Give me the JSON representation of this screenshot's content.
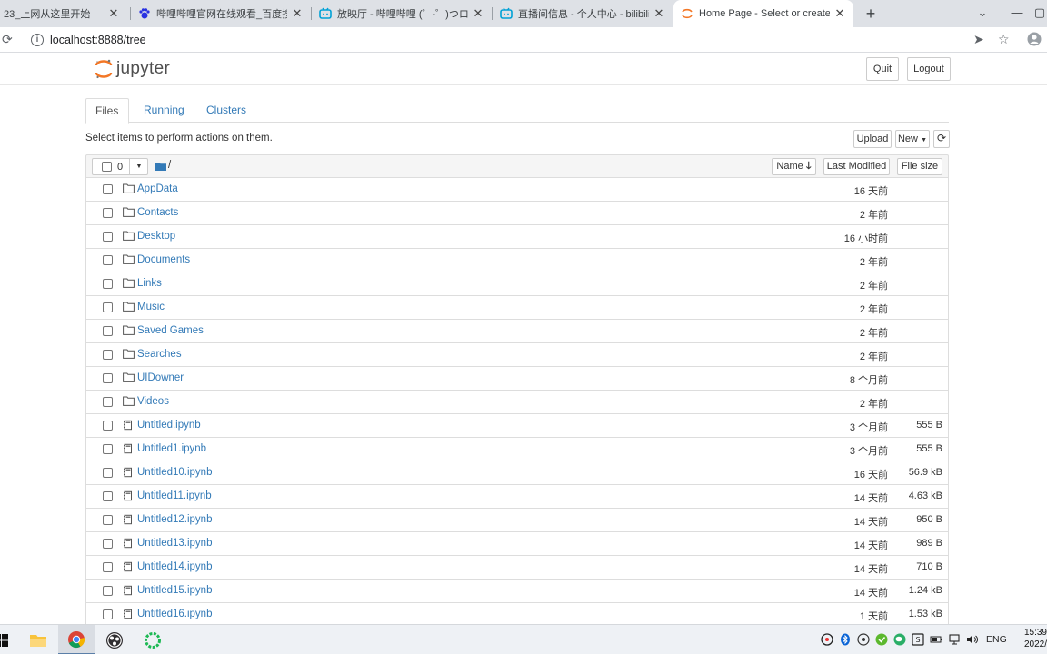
{
  "browser": {
    "tabs": [
      {
        "title": "23_上网从这里开始",
        "icon": "page-icon"
      },
      {
        "title": "哔哩哔哩官网在线观看_百度搜索",
        "icon": "baidu-paw-icon"
      },
      {
        "title": "放映厅 - 哔哩哔哩 (゜-゜)つロ 干",
        "icon": "bilibili-icon"
      },
      {
        "title": "直播间信息 - 个人中心 - bilibili l",
        "icon": "bilibili-icon"
      },
      {
        "title": "Home Page - Select or create",
        "icon": "jupyter-icon",
        "active": true
      }
    ],
    "url": "localhost:8888/tree"
  },
  "header": {
    "logo_text": "jupyter",
    "quit_label": "Quit",
    "logout_label": "Logout"
  },
  "nav": {
    "tabs": [
      "Files",
      "Running",
      "Clusters"
    ]
  },
  "hint": "Select items to perform actions on them.",
  "actions": {
    "upload_label": "Upload",
    "new_label": "New"
  },
  "list_header": {
    "selected_count": "0",
    "path": "/",
    "name_label": "Name",
    "modified_label": "Last Modified",
    "size_label": "File size"
  },
  "items": [
    {
      "type": "folder",
      "name": "AppData",
      "modified": "16 天前",
      "size": ""
    },
    {
      "type": "folder",
      "name": "Contacts",
      "modified": "2 年前",
      "size": ""
    },
    {
      "type": "folder",
      "name": "Desktop",
      "modified": "16 小时前",
      "size": ""
    },
    {
      "type": "folder",
      "name": "Documents",
      "modified": "2 年前",
      "size": ""
    },
    {
      "type": "folder",
      "name": "Links",
      "modified": "2 年前",
      "size": ""
    },
    {
      "type": "folder",
      "name": "Music",
      "modified": "2 年前",
      "size": ""
    },
    {
      "type": "folder",
      "name": "Saved Games",
      "modified": "2 年前",
      "size": ""
    },
    {
      "type": "folder",
      "name": "Searches",
      "modified": "2 年前",
      "size": ""
    },
    {
      "type": "folder",
      "name": "UIDowner",
      "modified": "8 个月前",
      "size": ""
    },
    {
      "type": "folder",
      "name": "Videos",
      "modified": "2 年前",
      "size": ""
    },
    {
      "type": "notebook",
      "name": "Untitled.ipynb",
      "modified": "3 个月前",
      "size": "555 B"
    },
    {
      "type": "notebook",
      "name": "Untitled1.ipynb",
      "modified": "3 个月前",
      "size": "555 B"
    },
    {
      "type": "notebook",
      "name": "Untitled10.ipynb",
      "modified": "16 天前",
      "size": "56.9 kB"
    },
    {
      "type": "notebook",
      "name": "Untitled11.ipynb",
      "modified": "14 天前",
      "size": "4.63 kB"
    },
    {
      "type": "notebook",
      "name": "Untitled12.ipynb",
      "modified": "14 天前",
      "size": "950 B"
    },
    {
      "type": "notebook",
      "name": "Untitled13.ipynb",
      "modified": "14 天前",
      "size": "989 B"
    },
    {
      "type": "notebook",
      "name": "Untitled14.ipynb",
      "modified": "14 天前",
      "size": "710 B"
    },
    {
      "type": "notebook",
      "name": "Untitled15.ipynb",
      "modified": "14 天前",
      "size": "1.24 kB"
    },
    {
      "type": "notebook",
      "name": "Untitled16.ipynb",
      "modified": "1 天前",
      "size": "1.53 kB"
    }
  ],
  "taskbar": {
    "language": "ENG",
    "time": "15:39",
    "date": "2022/"
  },
  "colors": {
    "link": "#337ab7",
    "jupyter_orange": "#f37726",
    "chrome_tabbar": "#dee1e6"
  }
}
